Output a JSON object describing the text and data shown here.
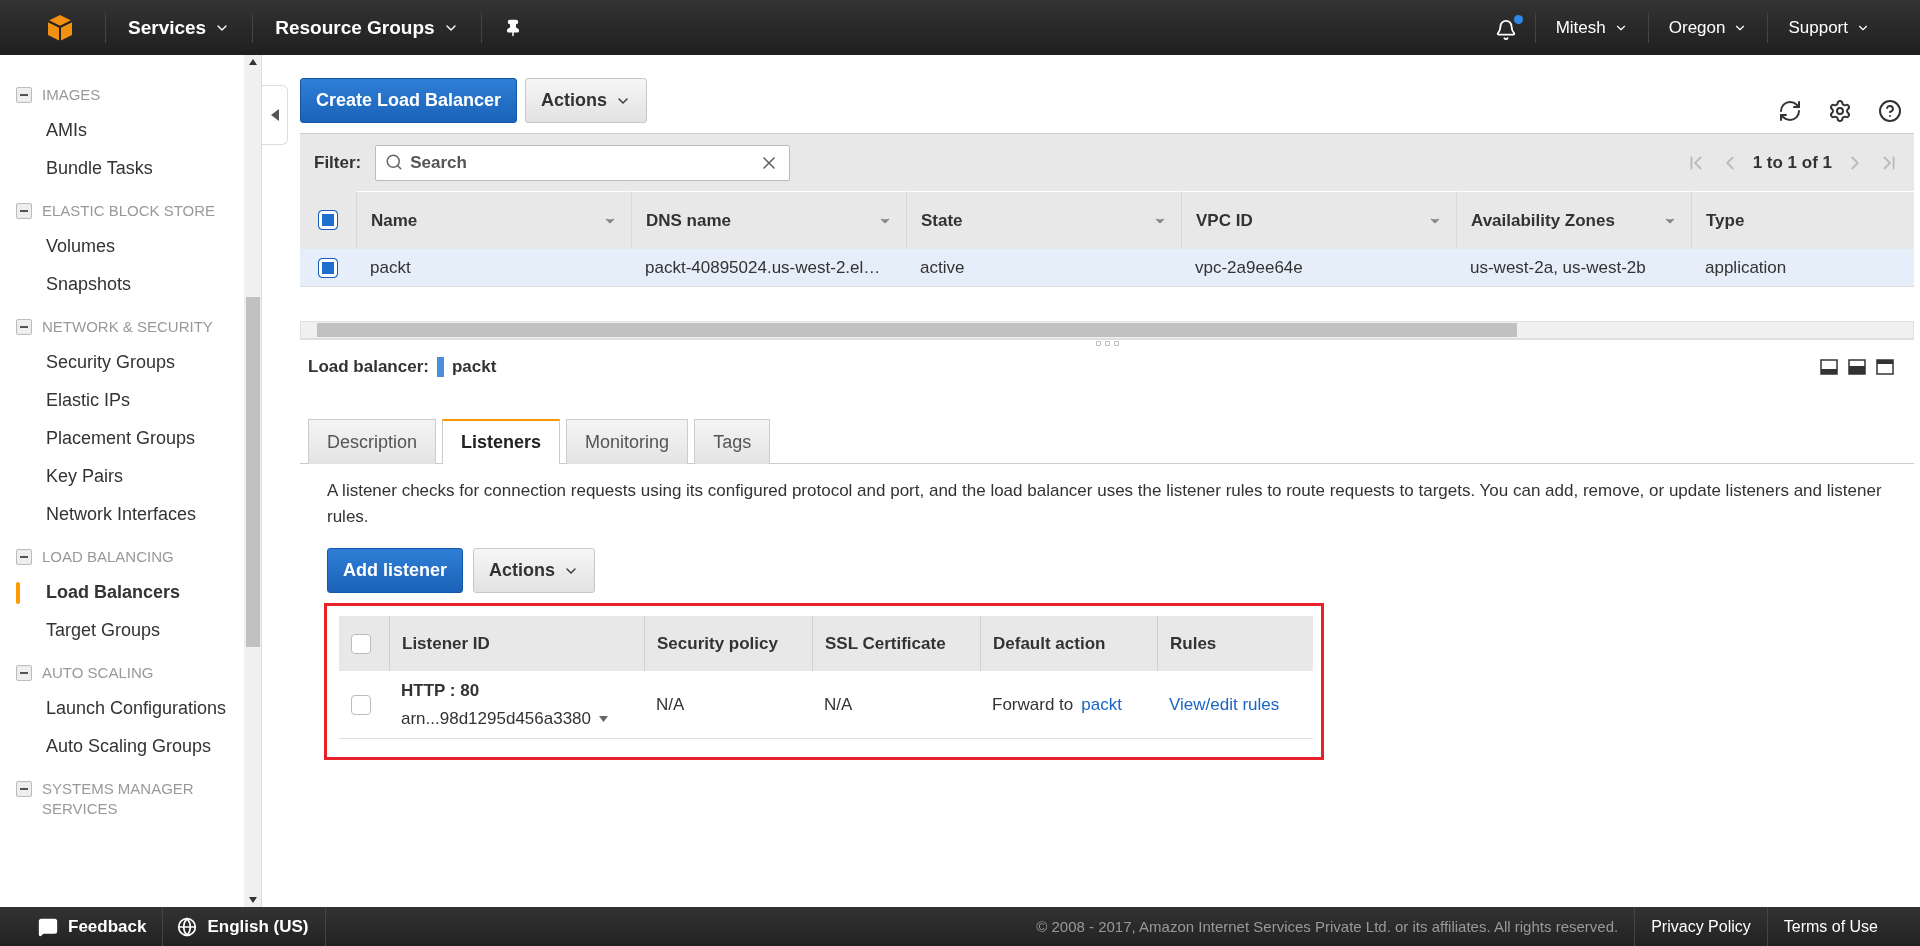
{
  "top_nav": {
    "menus": [
      {
        "label": "Services"
      },
      {
        "label": "Resource Groups"
      }
    ],
    "notification_unread": true,
    "right_menus": [
      {
        "label": "Mitesh"
      },
      {
        "label": "Oregon"
      },
      {
        "label": "Support"
      }
    ]
  },
  "sidebar": {
    "sections": [
      {
        "title": "IMAGES",
        "expanded": true,
        "items": [
          {
            "label": "AMIs",
            "selected": false
          },
          {
            "label": "Bundle Tasks",
            "selected": false
          }
        ]
      },
      {
        "title": "ELASTIC BLOCK STORE",
        "expanded": true,
        "items": [
          {
            "label": "Volumes",
            "selected": false
          },
          {
            "label": "Snapshots",
            "selected": false
          }
        ]
      },
      {
        "title": "NETWORK & SECURITY",
        "expanded": true,
        "items": [
          {
            "label": "Security Groups",
            "selected": false
          },
          {
            "label": "Elastic IPs",
            "selected": false
          },
          {
            "label": "Placement Groups",
            "selected": false
          },
          {
            "label": "Key Pairs",
            "selected": false
          },
          {
            "label": "Network Interfaces",
            "selected": false
          }
        ]
      },
      {
        "title": "LOAD BALANCING",
        "expanded": true,
        "items": [
          {
            "label": "Load Balancers",
            "selected": true
          },
          {
            "label": "Target Groups",
            "selected": false
          }
        ]
      },
      {
        "title": "AUTO SCALING",
        "expanded": true,
        "items": [
          {
            "label": "Launch Configurations",
            "selected": false
          },
          {
            "label": "Auto Scaling Groups",
            "selected": false
          }
        ]
      },
      {
        "title": "SYSTEMS MANAGER SERVICES",
        "expanded": true
      }
    ]
  },
  "toolbar": {
    "primary_button": "Create Load Balancer",
    "actions_button": "Actions"
  },
  "filter": {
    "label": "Filter:",
    "placeholder": "Search",
    "pagination": "1 to 1 of 1"
  },
  "table": {
    "header_checked": true,
    "columns": [
      "Name",
      "DNS name",
      "State",
      "VPC ID",
      "Availability Zones",
      "Type"
    ],
    "rows": [
      {
        "checked": true,
        "selected": true,
        "cells": [
          "packt",
          "packt-40895024.us-west-2.el…",
          "active",
          "vpc-2a9ee64e",
          "us-west-2a, us-west-2b",
          "application"
        ]
      }
    ]
  },
  "detail": {
    "label": "Load balancer:",
    "name": "packt",
    "tabs": [
      {
        "label": "Description",
        "selected": false
      },
      {
        "label": "Listeners",
        "selected": true
      },
      {
        "label": "Monitoring",
        "selected": false
      },
      {
        "label": "Tags",
        "selected": false
      }
    ],
    "description": "A listener checks for connection requests using its configured protocol and port, and the load balancer uses the listener rules to route requests to targets. You can add, remove, or update listeners and listener rules.",
    "add_button": "Add listener",
    "actions_button": "Actions",
    "listeners": {
      "highlighted": true,
      "header_checked": false,
      "columns": [
        "Listener ID",
        "Security policy",
        "SSL Certificate",
        "Default action",
        "Rules"
      ],
      "rows": [
        {
          "checked": false,
          "protocol": "HTTP : 80",
          "arn": "arn...98d1295d456a3380",
          "security_policy": "N/A",
          "ssl_certificate": "N/A",
          "default_action": "Forward to",
          "target": "packt",
          "rules_link": "View/edit rules"
        }
      ]
    }
  },
  "footer": {
    "feedback": "Feedback",
    "language": "English (US)",
    "copyright": "© 2008 - 2017, Amazon Internet Services Private Ltd. or its affiliates. All rights reserved.",
    "links": [
      "Privacy Policy",
      "Terms of Use"
    ]
  }
}
